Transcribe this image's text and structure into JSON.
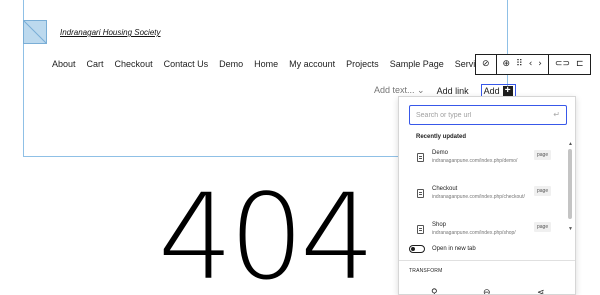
{
  "header": {
    "site_title": "Indranagari Housing Society"
  },
  "nav": {
    "items": [
      "About",
      "Cart",
      "Checkout",
      "Contact Us",
      "Demo",
      "Home",
      "My account",
      "Projects",
      "Sample Page",
      "Services"
    ]
  },
  "toolbar": {
    "items": [
      {
        "name": "link-status-icon",
        "glyph": "⊘"
      },
      {
        "name": "block-type-icon",
        "glyph": "⊕"
      },
      {
        "name": "drag-handle-icon",
        "glyph": "⠿"
      },
      {
        "name": "move-left-icon",
        "glyph": "‹"
      },
      {
        "name": "move-right-icon",
        "glyph": "›"
      },
      {
        "name": "link-icon",
        "glyph": "⊂⊃"
      },
      {
        "name": "submenu-icon",
        "glyph": "⊏"
      }
    ]
  },
  "add_row": {
    "add_text": "Add text...",
    "add_text_chevron": "⌄",
    "add_link": "Add link",
    "add_label": "Add",
    "plus_glyph": "+"
  },
  "page_404": {
    "text": "404"
  },
  "link_popover": {
    "search_placeholder": "Search or type url",
    "enter_glyph": "↵",
    "recent_header": "Recently updated",
    "results": [
      {
        "title": "Demo",
        "url": "indranaganpune.com/index.php/demo/",
        "badge": "page"
      },
      {
        "title": "Checkout",
        "url": "indranaganpune.com/index.php/checkout/",
        "badge": "page"
      },
      {
        "title": "Shop",
        "url": "indranaganpune.com/index.php/shop/",
        "badge": "page"
      }
    ],
    "new_tab_label": "Open in new tab",
    "transform_label": "TRANSFORM",
    "transform_icons": [
      {
        "name": "search-transform-icon",
        "glyph": "⚲"
      },
      {
        "name": "social-transform-icon",
        "glyph": "⊖"
      },
      {
        "name": "share-transform-icon",
        "glyph": "⋖"
      }
    ],
    "scroll_up": "▲",
    "scroll_down": "▼"
  },
  "colors": {
    "accent": "#3858e9",
    "frame": "#8fc0e6"
  }
}
